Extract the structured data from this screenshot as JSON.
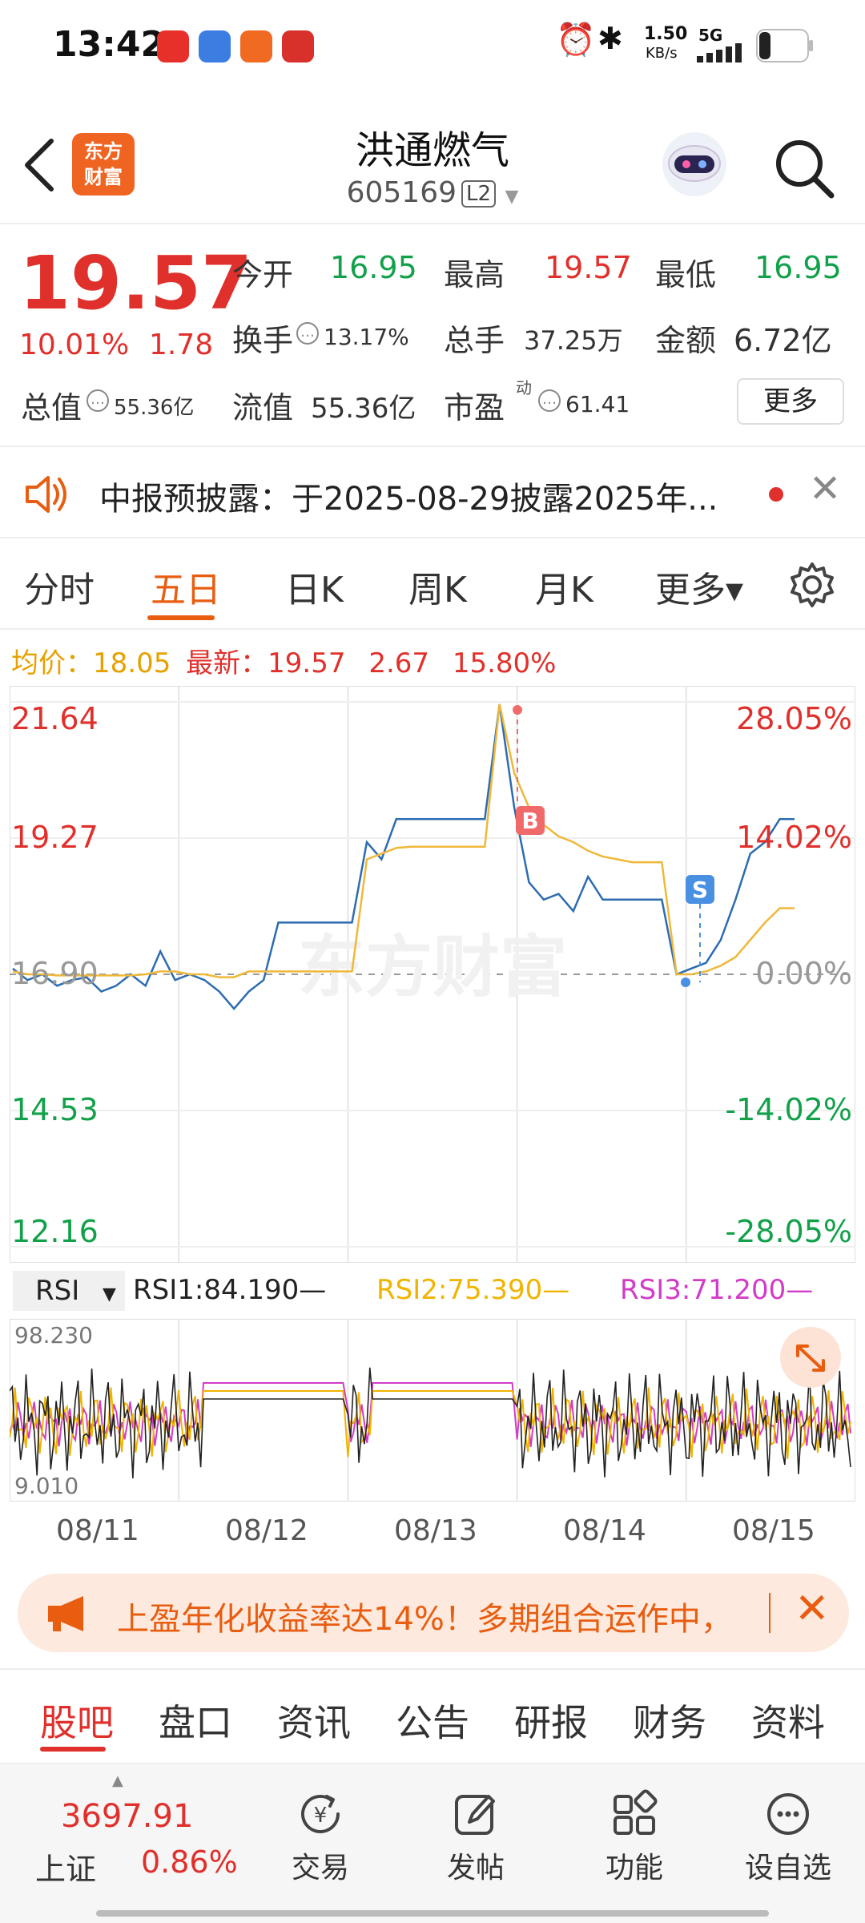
{
  "status_bar": {
    "time": "13:42",
    "net_speed": "1.50",
    "net_unit": "KB/s",
    "network": "5G"
  },
  "header": {
    "title": "洪通燃气",
    "code": "605169",
    "level": "L2",
    "logo_text_1": "东方",
    "logo_text_2": "财富"
  },
  "quote": {
    "price": "19.57",
    "change_pct": "10.01%",
    "change": "1.78",
    "open_label": "今开",
    "open": "16.95",
    "high_label": "最高",
    "high": "19.57",
    "low_label": "最低",
    "low": "16.95",
    "turnover_label": "换手",
    "turnover": "13.17%",
    "volume_label": "总手",
    "volume": "37.25万",
    "amount_label": "金额",
    "amount": "6.72亿",
    "mktcap_label": "总值",
    "mktcap": "55.36亿",
    "float_label": "流值",
    "float": "55.36亿",
    "pe_label": "市盈",
    "pe_sup": "动",
    "pe": "61.41",
    "more": "更多"
  },
  "notice": {
    "text": "中报预披露：于2025-08-29披露2025年..."
  },
  "chart_tabs": {
    "items": [
      "分时",
      "五日",
      "日K",
      "周K",
      "月K"
    ],
    "more": "更多▾",
    "active": "五日"
  },
  "avg_line": {
    "avg_label": "均价：",
    "avg": "18.05",
    "latest_label": "最新：",
    "latest": "19.57",
    "chg": "2.67",
    "chg_pct": "15.80%"
  },
  "chart_data": {
    "type": "line",
    "y_left_ticks": [
      "21.64",
      "19.27",
      "16.90",
      "14.53",
      "12.16"
    ],
    "y_right_ticks": [
      "28.05%",
      "14.02%",
      "0.00%",
      "-14.02%",
      "-28.05%"
    ],
    "ylim": [
      12.16,
      21.64
    ],
    "x_dates": [
      "08/11",
      "08/12",
      "08/13",
      "08/14",
      "08/15"
    ],
    "watermark": "东方财富",
    "series": [
      {
        "color": "#2d6cb0",
        "values": [
          17.0,
          16.8,
          16.9,
          16.7,
          16.8,
          16.85,
          16.6,
          16.7,
          16.9,
          16.7,
          17.3,
          16.8,
          16.9,
          16.8,
          16.6,
          16.3,
          16.6,
          16.8,
          17.8,
          17.8,
          17.8,
          17.8,
          17.8,
          17.8,
          19.2,
          18.9,
          19.6,
          19.6,
          19.6,
          19.6,
          19.6,
          19.6,
          19.6,
          21.6,
          19.8,
          18.5,
          18.2,
          18.3,
          18.0,
          18.6,
          18.2,
          18.2,
          18.2,
          18.2,
          18.2,
          16.9,
          17.0,
          17.1,
          17.5,
          18.2,
          19.0,
          19.2,
          19.6,
          19.6
        ]
      },
      {
        "color": "#f0b83a",
        "values": [
          16.95,
          16.9,
          16.9,
          16.88,
          16.88,
          16.88,
          16.88,
          16.88,
          16.88,
          16.9,
          16.95,
          16.95,
          16.9,
          16.9,
          16.85,
          16.85,
          16.95,
          16.95,
          16.95,
          16.95,
          16.95,
          16.95,
          16.95,
          16.95,
          18.9,
          19.0,
          19.1,
          19.12,
          19.12,
          19.12,
          19.12,
          19.12,
          19.12,
          21.6,
          20.4,
          19.8,
          19.5,
          19.3,
          19.2,
          19.05,
          18.95,
          18.9,
          18.85,
          18.85,
          18.85,
          16.9,
          16.9,
          16.95,
          17.05,
          17.2,
          17.5,
          17.8,
          18.05,
          18.05
        ]
      }
    ],
    "markers": [
      {
        "label": "B",
        "color": "#f06a6a"
      },
      {
        "label": "S",
        "color": "#4a90e2"
      }
    ]
  },
  "rsi": {
    "selector": "RSI",
    "rsi1_label": "RSI1:84.190—",
    "rsi2_label": "RSI2:75.390—",
    "rsi3_label": "RSI3:71.200—",
    "rsi_max": "98.230",
    "rsi_min": "9.010",
    "colors": {
      "rsi1": "#222222",
      "rsi2": "#f0b400",
      "rsi3": "#d23cc8"
    }
  },
  "ad": {
    "text": "上盈年化收益率达14%！多期组合运作中，"
  },
  "bottom_tabs": {
    "items": [
      "股吧",
      "盘口",
      "资讯",
      "公告",
      "研报",
      "财务",
      "资料"
    ],
    "active": "股吧"
  },
  "bottom_nav": {
    "index_value": "3697.91",
    "index_name": "上证",
    "index_pct": "0.86%",
    "items": [
      "交易",
      "发帖",
      "功能",
      "设自选"
    ]
  }
}
